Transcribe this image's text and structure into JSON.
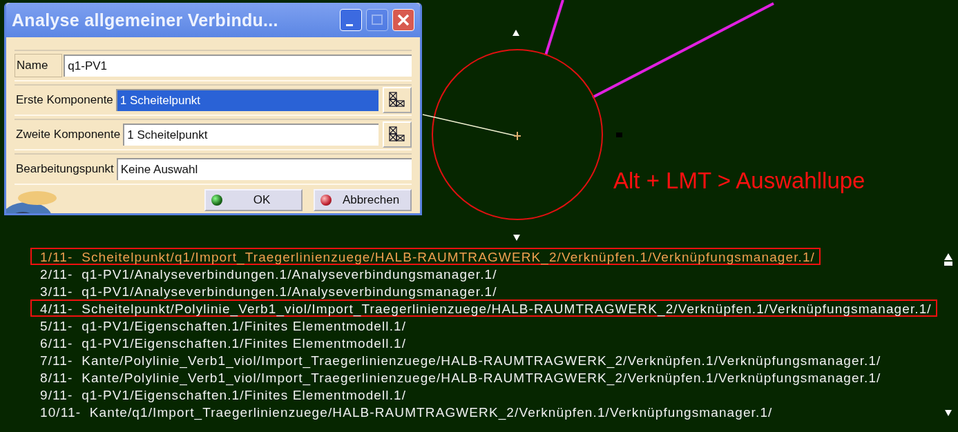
{
  "dialog": {
    "title": "Analyse allgemeiner Verbindu...",
    "window_buttons": [
      {
        "kind": "minimize",
        "disabled": false
      },
      {
        "kind": "maximize",
        "disabled": true
      },
      {
        "kind": "close",
        "disabled": false
      }
    ],
    "fields": [
      {
        "kind": "text",
        "label": "Name",
        "value": "q1-PV1",
        "selected": false
      },
      {
        "kind": "picker",
        "label": "Erste Komponente",
        "value": "1 Scheitelpunkt",
        "selected": true
      },
      {
        "kind": "picker",
        "label": "Zweite Komponente",
        "value": "1 Scheitelpunkt",
        "selected": false
      },
      {
        "kind": "plain",
        "label": "Bearbeitungspunkt",
        "value": "Keine Auswahl",
        "selected": false
      }
    ],
    "buttons": [
      {
        "kind": "ok",
        "label": "OK"
      },
      {
        "kind": "cancel",
        "label": "Abbrechen"
      }
    ]
  },
  "viewport": {
    "annotation": "Alt + LMT > Auswahllupe"
  },
  "selection_list": {
    "items": [
      {
        "text": "1/11-  Scheitelpunkt/q1/Import_Traegerlinienzuege/HALB-RAUMTRAGWERK_2/Verknüpfen.1/Verknüpfungsmanager.1/",
        "selected": true,
        "highlighted": true
      },
      {
        "text": "2/11-  q1-PV1/Analyseverbindungen.1/Analyseverbindungsmanager.1/",
        "selected": false,
        "highlighted": false
      },
      {
        "text": "3/11-  q1-PV1/Analyseverbindungen.1/Analyseverbindungsmanager.1/",
        "selected": false,
        "highlighted": false
      },
      {
        "text": "4/11-  Scheitelpunkt/Polylinie_Verb1_viol/Import_Traegerlinienzuege/HALB-RAUMTRAGWERK_2/Verknüpfen.1/Verknüpfungsmanager.1/",
        "selected": false,
        "highlighted": true
      },
      {
        "text": "5/11-  q1-PV1/Eigenschaften.1/Finites Elementmodell.1/",
        "selected": false,
        "highlighted": false
      },
      {
        "text": "6/11-  q1-PV1/Eigenschaften.1/Finites Elementmodell.1/",
        "selected": false,
        "highlighted": false
      },
      {
        "text": "7/11-  Kante/Polylinie_Verb1_viol/Import_Traegerlinienzuege/HALB-RAUMTRAGWERK_2/Verknüpfen.1/Verknüpfungsmanager.1/",
        "selected": false,
        "highlighted": false
      },
      {
        "text": "8/11-  Kante/Polylinie_Verb1_viol/Import_Traegerlinienzuege/HALB-RAUMTRAGWERK_2/Verknüpfen.1/Verknüpfungsmanager.1/",
        "selected": false,
        "highlighted": false
      },
      {
        "text": "9/11-  q1-PV1/Eigenschaften.1/Finites Elementmodell.1/",
        "selected": false,
        "highlighted": false
      },
      {
        "text": "10/11-  Kante/q1/Import_Traegerlinienzuege/HALB-RAUMTRAGWERK_2/Verknüpfen.1/Verknüpfungsmanager.1/",
        "selected": false,
        "highlighted": false
      }
    ]
  }
}
